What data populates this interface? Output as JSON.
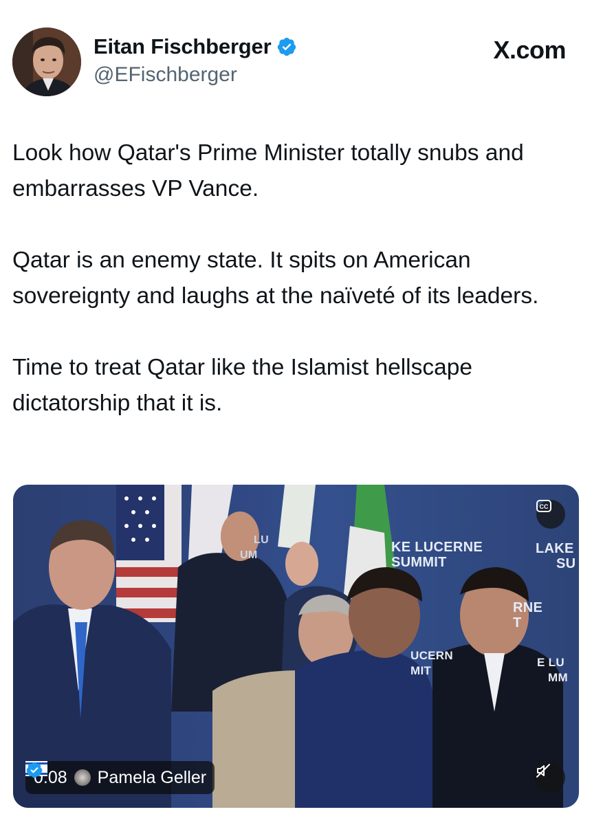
{
  "author": {
    "display_name": "Eitan Fischberger",
    "handle": "@EFischberger",
    "verified": true
  },
  "site_label": "X.com",
  "tweet": {
    "paragraphs": [
      "Look how Qatar's Prime Minister totally snubs and embarrasses VP Vance.",
      "Qatar is an enemy state. It spits on American sovereignty and laughs at the naïveté of its leaders.",
      "Time to treat Qatar like the Islamist hellscape dictatorship that it is."
    ]
  },
  "video": {
    "timestamp": "0:08",
    "source_name": "Pamela Geller",
    "source_flags": [
      "us-flag-icon",
      "israel-flag-icon"
    ],
    "source_verified": true,
    "banner_lines": [
      "KE LUCERNE",
      "SUMMIT",
      "LAKE",
      "SU",
      "LU",
      "UM",
      "RNE",
      "T",
      "UCERN",
      "MIT",
      "E LU",
      "MM"
    ]
  },
  "colors": {
    "text": "#0f1419",
    "secondary": "#536471",
    "verified": "#1d9bf0",
    "backdrop": "#2f4680"
  }
}
